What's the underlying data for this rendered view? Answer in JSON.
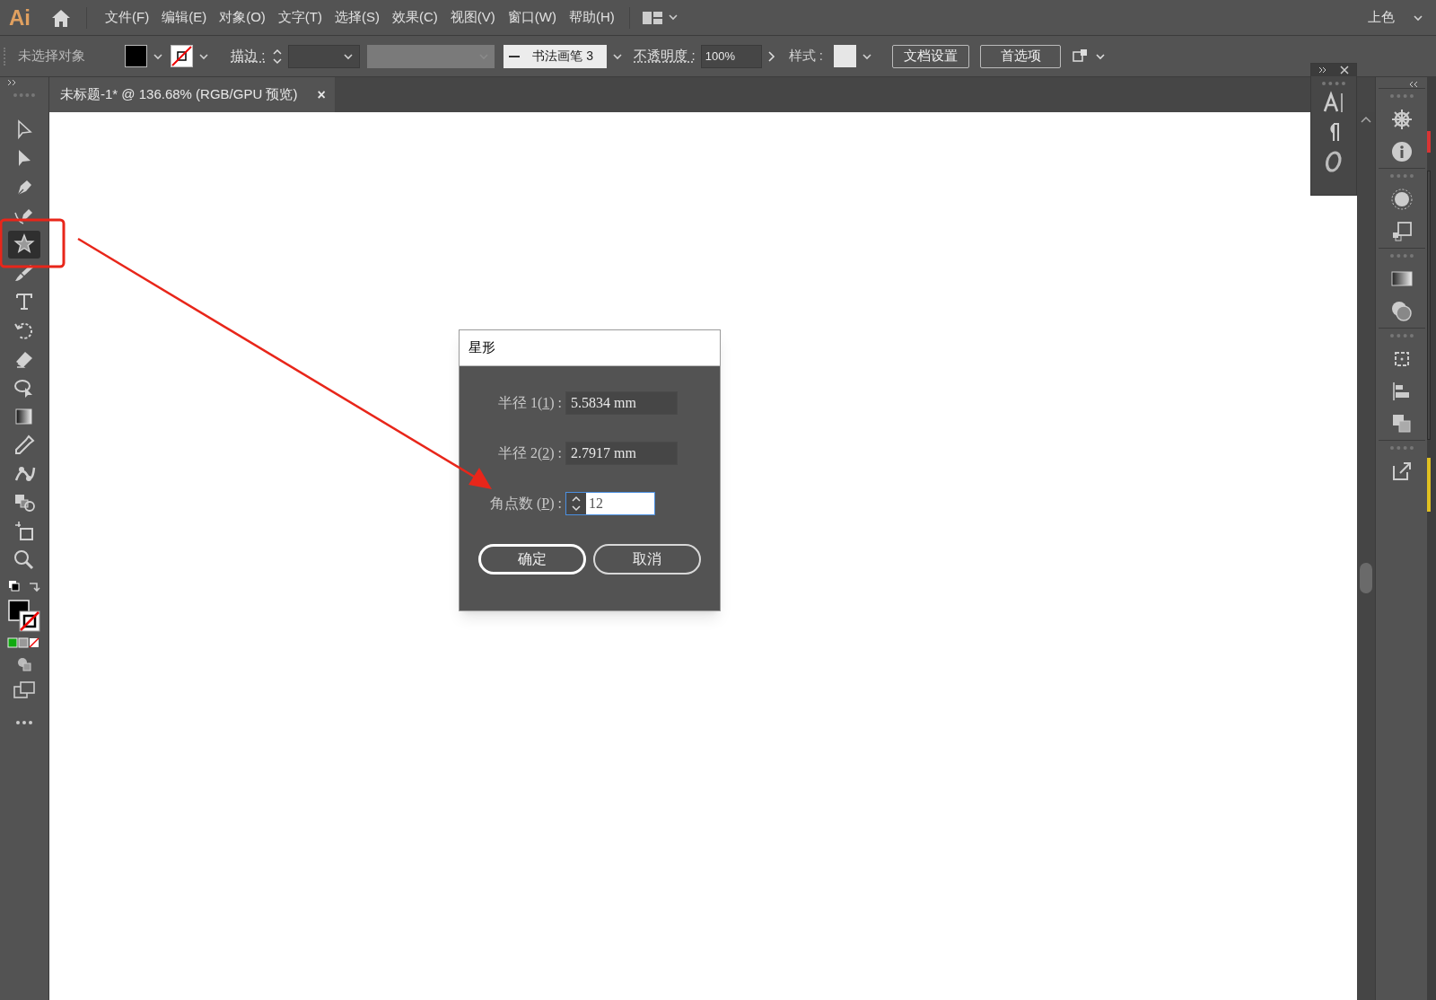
{
  "app_bar": {
    "logo": "Ai",
    "menus": [
      "文件(F)",
      "编辑(E)",
      "对象(O)",
      "文字(T)",
      "选择(S)",
      "效果(C)",
      "视图(V)",
      "窗口(W)",
      "帮助(H)"
    ],
    "workspace": "上色"
  },
  "control_bar": {
    "selection_status": "未选择对象",
    "stroke_label": "描边 :",
    "brush": "书法画笔 3",
    "opacity_label": "不透明度 :",
    "opacity_value": "100%",
    "style_label": "样式 :",
    "buttons": [
      "文档设置",
      "首选项"
    ]
  },
  "document_tab": {
    "title": "未标题-1* @ 136.68% (RGB/GPU 预览)",
    "close": "×"
  },
  "tools": [
    {
      "kind": "selection",
      "selected": false
    },
    {
      "kind": "direct",
      "selected": false
    },
    {
      "kind": "pen",
      "selected": false
    },
    {
      "kind": "curvature",
      "selected": false
    },
    {
      "kind": "star",
      "selected": true
    },
    {
      "kind": "brush",
      "selected": false
    },
    {
      "kind": "type",
      "selected": false
    },
    {
      "kind": "rotate",
      "selected": false
    },
    {
      "kind": "eraser",
      "selected": false
    },
    {
      "kind": "lasso",
      "selected": false
    },
    {
      "kind": "gradient",
      "selected": false
    },
    {
      "kind": "eyedropper",
      "selected": false
    },
    {
      "kind": "warp",
      "selected": false
    },
    {
      "kind": "shapes",
      "selected": false
    },
    {
      "kind": "artboard",
      "selected": false
    },
    {
      "kind": "zoom",
      "selected": false
    }
  ],
  "dialog": {
    "title": "星形",
    "fields": [
      {
        "label_before": "半径 1(",
        "mnemonic": "1",
        "label_after": ") :",
        "value": "5.5834 mm",
        "kind": "text",
        "focused": false
      },
      {
        "label_before": "半径 2(",
        "mnemonic": "2",
        "label_after": ") :",
        "value": "2.7917 mm",
        "kind": "text",
        "focused": false
      },
      {
        "label_before": "角点数 (",
        "mnemonic": "P",
        "label_after": ") :",
        "value": "12",
        "kind": "spinner",
        "focused": true
      }
    ],
    "buttons": [
      "确定",
      "取消"
    ]
  }
}
